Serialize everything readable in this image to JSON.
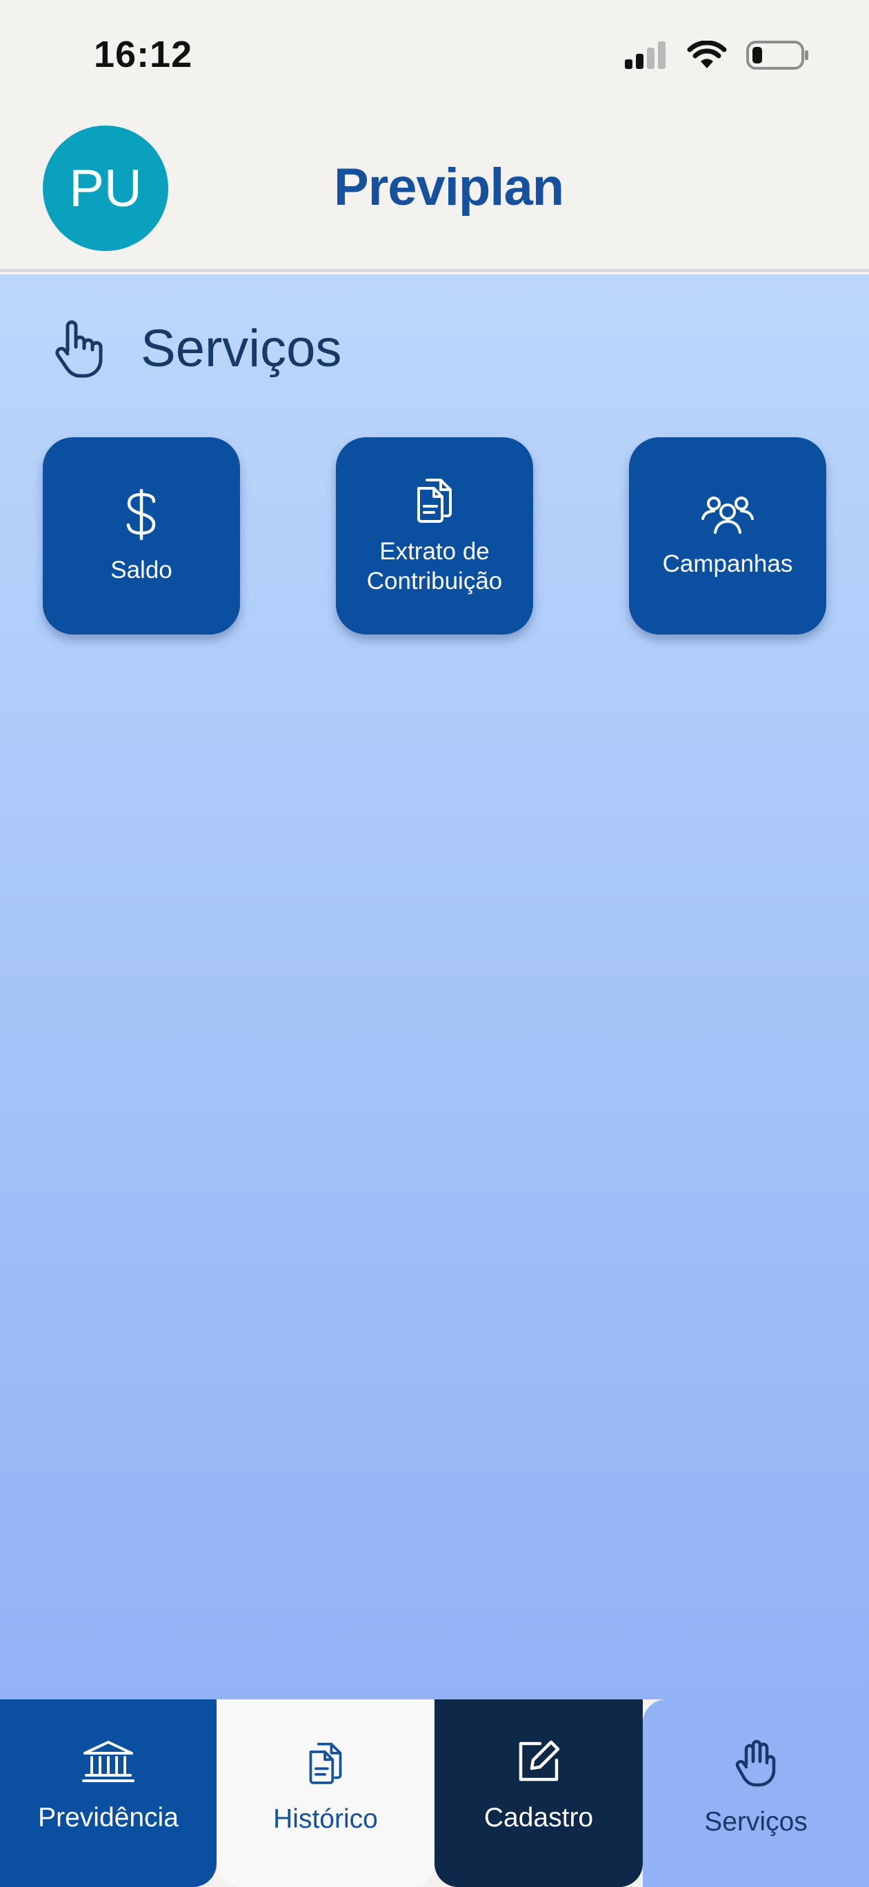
{
  "status_bar": {
    "time": "16:12"
  },
  "header": {
    "avatar_initials": "PU",
    "logo": "Previplan"
  },
  "main": {
    "section_title": "Serviços",
    "cards": [
      {
        "label": "Saldo",
        "icon": "dollar-icon"
      },
      {
        "label_line1": "Extrato de",
        "label_line2": "Contribuição",
        "icon": "documents-icon"
      },
      {
        "label": "Campanhas",
        "icon": "users-icon"
      }
    ]
  },
  "bottom_nav": {
    "items": [
      {
        "label": "Previdência",
        "icon": "bank-icon"
      },
      {
        "label": "Histórico",
        "icon": "documents-icon"
      },
      {
        "label": "Cadastro",
        "icon": "edit-icon"
      },
      {
        "label": "Serviços",
        "icon": "hand-icon",
        "active": true
      }
    ]
  },
  "colors": {
    "primary": "#0b50a0",
    "dark": "#0e2849",
    "accent_avatar": "#0aa1bf",
    "text_dark": "#173968"
  }
}
